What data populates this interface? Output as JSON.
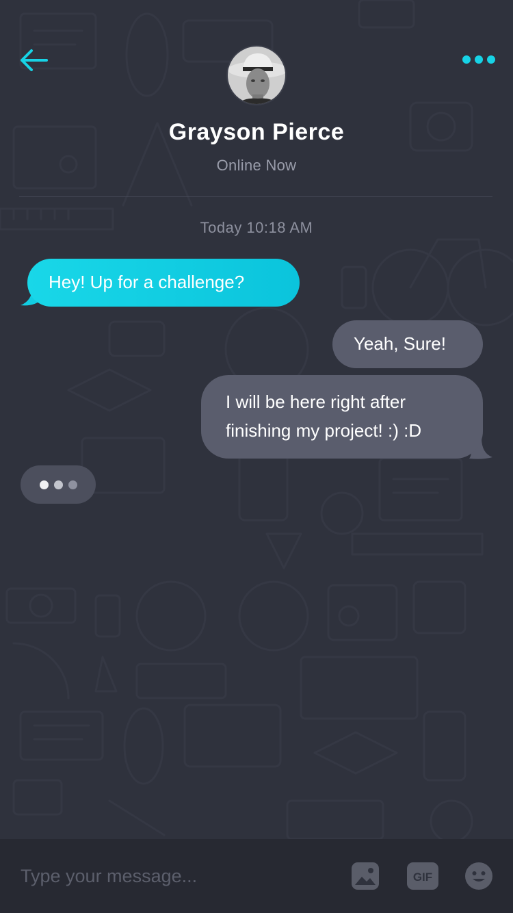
{
  "header": {
    "contact_name": "Grayson Pierce",
    "status": "Online Now"
  },
  "conversation": {
    "timestamp": "Today 10:18 AM",
    "messages": [
      {
        "direction": "incoming",
        "text": "Hey! Up for a challenge?"
      },
      {
        "direction": "outgoing",
        "text": "Yeah, Sure!"
      },
      {
        "direction": "outgoing",
        "lines": [
          "I will be here right after",
          "finishing my project! :) :D"
        ]
      }
    ],
    "typing_indicator_visible": true
  },
  "composer": {
    "placeholder": "Type your message...",
    "value": "",
    "gif_label": "GIF"
  },
  "icons": {
    "back": "arrow-left-icon",
    "more": "more-dots-icon",
    "image": "image-icon",
    "gif": "gif-icon",
    "emoji": "emoji-icon"
  },
  "colors": {
    "background": "#2f323d",
    "accent": "#17d3e6",
    "incoming_bubble": "#12cde2",
    "outgoing_bubble": "#5a5d6d",
    "composer_bg": "#272932",
    "muted_text": "#9a9dab"
  }
}
